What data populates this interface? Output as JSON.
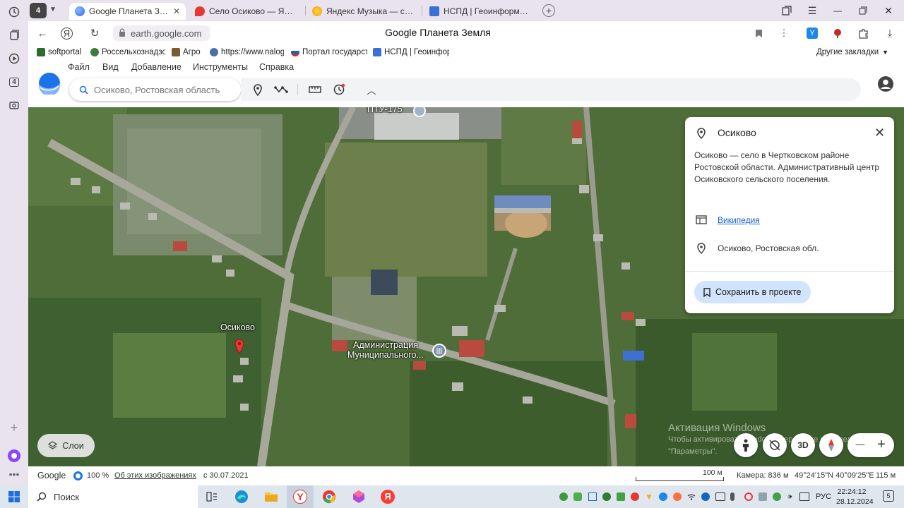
{
  "sidebar": {
    "tab_count_badge": "4"
  },
  "tabs": [
    {
      "title": "Google Планета Земля",
      "active": true,
      "close": "✕",
      "favicon_color": "#4a8af4"
    },
    {
      "title": "Село Осиково — Яндекс Карты",
      "active": false,
      "favicon_color": "#e53935"
    },
    {
      "title": "Яндекс Музыка — собираем музыку",
      "active": false,
      "favicon_color": "#f5b400"
    },
    {
      "title": "НСПД | Геоинформационный портал",
      "active": false,
      "favicon_color": "#3a6fd8"
    }
  ],
  "browser": {
    "url": "earth.google.com",
    "page_title": "Google Планета Земля",
    "tab_badge": "4"
  },
  "bookmarks": [
    {
      "label": "softportal",
      "icon_color": "#2f6b2f"
    },
    {
      "label": "Россельхознадзор",
      "icon_color": "#3d7a3d"
    },
    {
      "label": "Агро",
      "icon_color": "#7a5a2e"
    },
    {
      "label": "https://www.nalog.gov.ru",
      "icon_color": "#4a6fa5"
    },
    {
      "label": "Портал государственных услуг",
      "icon_color": "#d62d20"
    },
    {
      "label": "НСПД | Геоинформационный портал",
      "icon_color": "#3a6fd8"
    }
  ],
  "other_bookmarks": "Другие закладки",
  "menu": [
    "Файл",
    "Вид",
    "Добавление",
    "Инструменты",
    "Справка"
  ],
  "search": {
    "placeholder": "Осиково, Ростовская область"
  },
  "map_labels": {
    "school": "ПТУ-175",
    "village": "Осиково",
    "admin_line1": "Администрация",
    "admin_line2": "Муниципального..."
  },
  "infocard": {
    "title": "Осиково",
    "description": "Осиково — село в Чертковском районе Ростовской области. Административный центр Осиковского сельского поселения.",
    "wiki_link": "Википедия",
    "address": "Осиково, Ростовская обл.",
    "save_button": "Сохранить в проекте"
  },
  "layers_button": "Слои",
  "map_controls": {
    "three_d": "3D",
    "zoom_out": "—",
    "zoom_in": "+"
  },
  "watermark": {
    "line1": "Активация Windows",
    "line2": "Чтобы активировать Windows, перейдите в раздел",
    "line3": "\"Параметры\"."
  },
  "status": {
    "google": "Google",
    "loaded_pct": "100 %",
    "about_images": "Об этих изображениях",
    "date": "с 30.07.2021",
    "scale": "100 м",
    "camera": "Камера: 836 м",
    "coords": "49°24'15\"N 40°09'25\"E",
    "elevation": "115 м"
  },
  "taskbar": {
    "search_label": "Поиск",
    "lang": "РУС",
    "time": "22:24:12",
    "date": "28.12.2024"
  }
}
